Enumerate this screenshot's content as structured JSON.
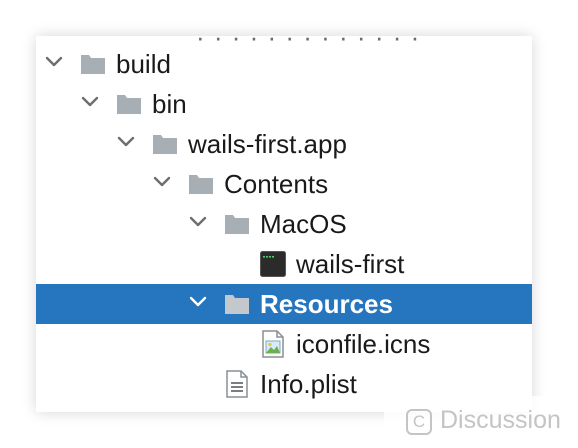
{
  "top_cut_text": "· · · · ·   · · · · ·  ·  · ·",
  "tree": {
    "rows": [
      {
        "label": "build",
        "icon": "folder-icon",
        "expanded": true
      },
      {
        "label": "bin",
        "icon": "folder-icon",
        "expanded": true
      },
      {
        "label": "wails-first.app",
        "icon": "folder-icon",
        "expanded": true
      },
      {
        "label": "Contents",
        "icon": "folder-icon",
        "expanded": true
      },
      {
        "label": "MacOS",
        "icon": "folder-icon",
        "expanded": true
      },
      {
        "label": "wails-first",
        "icon": "terminal-executable-icon"
      },
      {
        "label": "Resources",
        "icon": "folder-icon",
        "expanded": true,
        "selected": true
      },
      {
        "label": "iconfile.icns",
        "icon": "image-file-icon"
      },
      {
        "label": "Info.plist",
        "icon": "plist-file-icon"
      }
    ]
  },
  "watermark": {
    "logo_char": "C",
    "text": "Discussion"
  },
  "colors": {
    "selection": "#2675bf",
    "folder": "#a7aeb4",
    "chevron": "#6e6e6e"
  }
}
